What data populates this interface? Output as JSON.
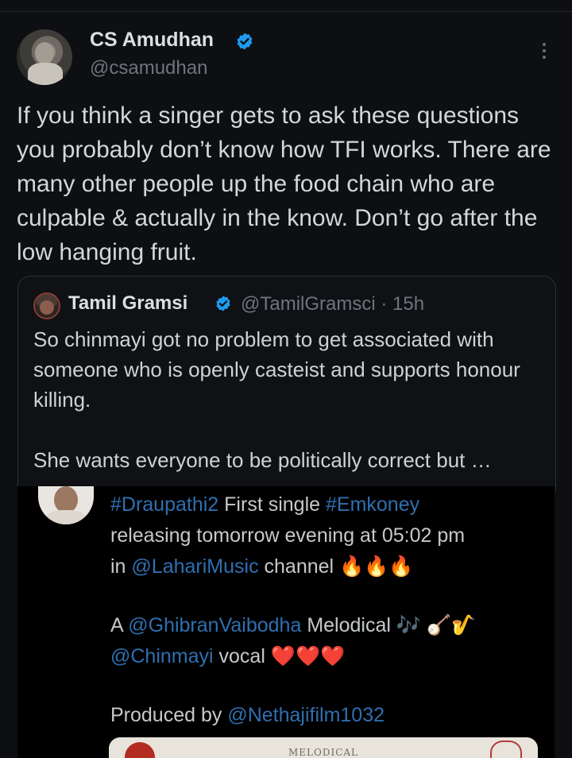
{
  "tweet": {
    "author_name": "CS Amudhan",
    "author_handle": "@csamudhan",
    "text": "If you think a singer gets to ask these questions you probably don’t know how TFI works. There are many other people up the food chain who are culpable & actually in the know. Don’t go after the low hanging fruit."
  },
  "quoted_tweet": {
    "author_name": "Tamil Gramsi",
    "author_handle": "@TamilGramsci",
    "meta": "@TamilGramsci · 15h",
    "paragraphs": [
      "So chinmayi got no problem to get associated with someone who is openly casteist and supports honour killing.",
      "She wants everyone to be politically correct but …"
    ]
  },
  "embedded_post": {
    "line1_link1": "#Draupathi2",
    "line1_text": " First single ",
    "line1_link2": "#Emkoney",
    "line2": "releasing tomorrow evening at 05:02 pm",
    "line3_prefix": "in ",
    "line3_link": "@LahariMusic",
    "line3_suffix": " channel 🔥🔥🔥",
    "line4_prefix": "A ",
    "line4_link": "@GhibranVaibodha",
    "line4_suffix": " Melodical 🎶 🪕🎷",
    "line5_link": "@Chinmayi",
    "line5_suffix": " vocal ❤️❤️❤️",
    "line6_prefix": "Produced by ",
    "line6_link": "@Nethajifilm1032",
    "image_caption": "MELODICAL"
  },
  "colors": {
    "background": "#0d0f12",
    "verified": "#1d9bf0",
    "link": "#2f6fb0"
  },
  "icons": [
    "verified-badge-icon",
    "more-options-icon"
  ]
}
